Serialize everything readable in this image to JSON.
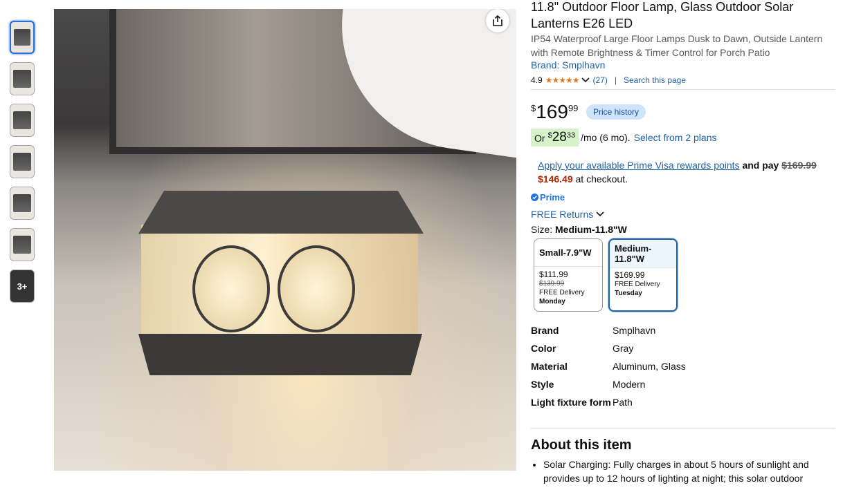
{
  "thumbnails": {
    "more_label": "3+"
  },
  "product": {
    "title": "11.8\" Outdoor Floor Lamp, Glass Outdoor Solar Lanterns E26 LED",
    "subtitle": "IP54 Waterproof Large Floor Lamps Dusk to Dawn, Outside Lantern with Remote Brightness & Timer Control for Porch Patio",
    "brand_link": "Brand: Smplhavn",
    "rating": "4.9",
    "stars": "★★★★★",
    "review_count": "(27)",
    "search_page": "Search this page"
  },
  "price": {
    "symbol": "$",
    "whole": "169",
    "fraction": "99",
    "history_label": "Price history"
  },
  "monthly": {
    "or": "Or",
    "symbol": "$",
    "whole": "28",
    "fraction": "33",
    "term": "/mo (6 mo).",
    "plans_link": "Select from 2 plans"
  },
  "promo": {
    "link": "Apply your available Prime Visa rewards points",
    "and_pay": "and pay",
    "original": "$169.99",
    "discounted": "$146.49",
    "suffix": "at checkout."
  },
  "prime": {
    "label": "Prime"
  },
  "returns": {
    "label": "FREE Returns"
  },
  "size": {
    "label": "Size:",
    "selected": "Medium-11.8\"W",
    "options": [
      {
        "title": "Small-7.9\"W",
        "price": "$111.99",
        "list_price": "$139.99",
        "delivery": "FREE Delivery",
        "day": "Monday"
      },
      {
        "title": "Medium-11.8\"W",
        "price": "$169.99",
        "delivery": "FREE Delivery",
        "day": "Tuesday"
      }
    ]
  },
  "specs": [
    {
      "key": "Brand",
      "value": "Smplhavn"
    },
    {
      "key": "Color",
      "value": "Gray"
    },
    {
      "key": "Material",
      "value": "Aluminum, Glass"
    },
    {
      "key": "Style",
      "value": "Modern"
    },
    {
      "key": "Light fixture form",
      "value": "Path"
    }
  ],
  "about": {
    "heading": "About this item",
    "bullets": [
      "Solar Charging: Fully charges in about 5 hours of sunlight and provides up to 12 hours of lighting at night; this solar outdoor"
    ]
  },
  "icons": {
    "share": "share-icon",
    "chevron": "chevron-down-icon",
    "check": "check-icon"
  }
}
